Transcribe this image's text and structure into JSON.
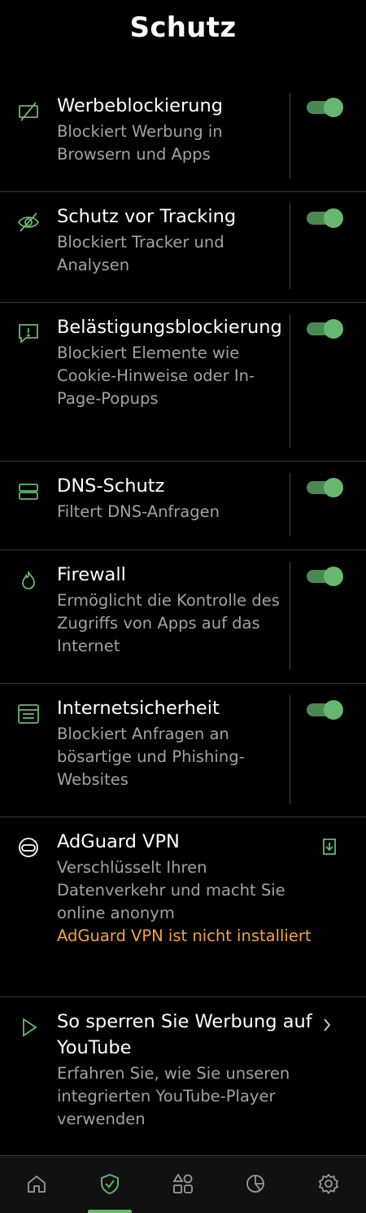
{
  "header": {
    "title": "Schutz"
  },
  "items": [
    {
      "title": "Werbeblockierung",
      "desc": "Blockiert Werbung in Browsern und Apps",
      "enabled": true
    },
    {
      "title": "Schutz vor Tracking",
      "desc": "Blockiert Tracker und Analysen",
      "enabled": true
    },
    {
      "title": "Belästigungsblockierung",
      "desc": "Blockiert Elemente wie Cookie-Hinweise oder In-Page-Popups",
      "enabled": true
    },
    {
      "title": "DNS-Schutz",
      "desc": "Filtert DNS-Anfragen",
      "enabled": true
    },
    {
      "title": "Firewall",
      "desc": "Ermöglicht die Kontrolle des Zugriffs von Apps auf das Internet",
      "enabled": true
    },
    {
      "title": "Internetsicherheit",
      "desc": "Blockiert Anfragen an bösartige und Phishing-Websites",
      "enabled": true
    }
  ],
  "vpn": {
    "title": "AdGuard VPN",
    "desc": "Verschlüsselt Ihren Datenverkehr und macht Sie online anonym",
    "status": "AdGuard VPN ist nicht installiert"
  },
  "youtube": {
    "title": "So sperren Sie Werbung auf YouTube",
    "desc": "Erfahren Sie, wie Sie unseren integrierten YouTube-Player verwenden"
  },
  "colors": {
    "accent": "#67b86e",
    "warning": "#f2a33c",
    "background": "#000000"
  },
  "bottom_nav": {
    "active": "protection",
    "items": [
      "home-icon",
      "shield-check-icon",
      "apps-grid-icon",
      "statistics-pie-icon",
      "settings-gear-icon"
    ]
  }
}
